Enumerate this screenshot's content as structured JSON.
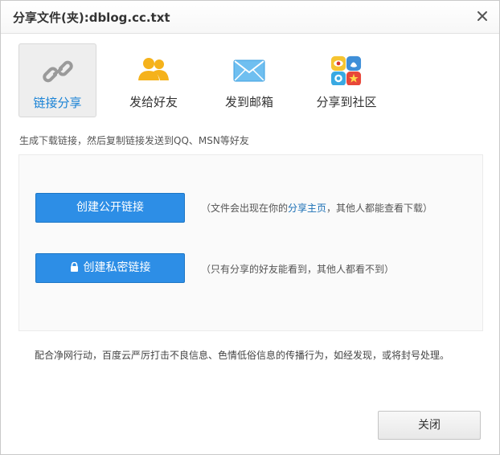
{
  "dialog": {
    "title": "分享文件(夹):dblog.cc.txt",
    "close_icon": "close-x-icon"
  },
  "tabs": [
    {
      "label": "链接分享",
      "icon": "link-icon",
      "active": true
    },
    {
      "label": "发给好友",
      "icon": "friends-icon",
      "active": false
    },
    {
      "label": "发到邮箱",
      "icon": "mail-envelope-icon",
      "active": false
    },
    {
      "label": "分享到社区",
      "icon": "community-apps-icon",
      "active": false
    }
  ],
  "tip": "生成下载链接，然后复制链接发送到QQ、MSN等好友",
  "public_link": {
    "button_label": "创建公开链接",
    "desc_prefix": "（文件会出现在你的",
    "desc_link": "分享主页",
    "desc_suffix": "，其他人都能查看下载）"
  },
  "private_link": {
    "button_label": "创建私密链接",
    "icon": "lock-icon",
    "desc": "（只有分享的好友能看到，其他人都看不到）"
  },
  "notice": "配合净网行动，百度云严厉打击不良信息、色情低俗信息的传播行为，如经发现，或将封号处理。",
  "footer": {
    "close_label": "关闭"
  },
  "colors": {
    "accent": "#2d8ee6",
    "active_tab_text": "#1a83d6",
    "link": "#1a6fb5",
    "friends_icon": "#f5b21b",
    "mail_icon": "#5ab4ec"
  }
}
